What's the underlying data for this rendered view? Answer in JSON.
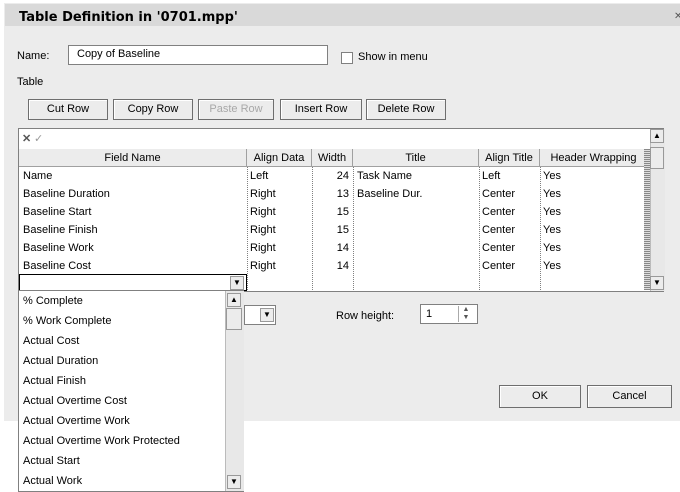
{
  "window": {
    "title": "Table Definition in '0701.mpp'"
  },
  "name": {
    "label": "Name:",
    "value": "Copy of Baseline"
  },
  "show_in_menu": {
    "label": "Show in menu",
    "checked": false
  },
  "table_label": "Table",
  "toolbar": {
    "cut_row": "Cut Row",
    "copy_row": "Copy Row",
    "paste_row": "Paste Row",
    "insert_row": "Insert Row",
    "delete_row": "Delete Row"
  },
  "grid": {
    "columns": [
      "Field Name",
      "Align Data",
      "Width",
      "Title",
      "Align Title",
      "Header Wrapping"
    ],
    "rows": [
      [
        "Name",
        "Left",
        "24",
        "Task Name",
        "Left",
        "Yes"
      ],
      [
        "Baseline Duration",
        "Right",
        "13",
        "Baseline Dur.",
        "Center",
        "Yes"
      ],
      [
        "Baseline Start",
        "Right",
        "15",
        "",
        "Center",
        "Yes"
      ],
      [
        "Baseline Finish",
        "Right",
        "15",
        "",
        "Center",
        "Yes"
      ],
      [
        "Baseline Work",
        "Right",
        "14",
        "",
        "Center",
        "Yes"
      ],
      [
        "Baseline Cost",
        "Right",
        "14",
        "",
        "Center",
        "Yes"
      ]
    ]
  },
  "field_dropdown": {
    "items": [
      "% Complete",
      "% Work Complete",
      "Actual Cost",
      "Actual Duration",
      "Actual Finish",
      "Actual Overtime Cost",
      "Actual Overtime Work",
      "Actual Overtime Work Protected",
      "Actual Start",
      "Actual Work"
    ]
  },
  "row_height": {
    "label": "Row height:",
    "value": "1"
  },
  "buttons": {
    "ok": "OK",
    "cancel": "Cancel"
  }
}
